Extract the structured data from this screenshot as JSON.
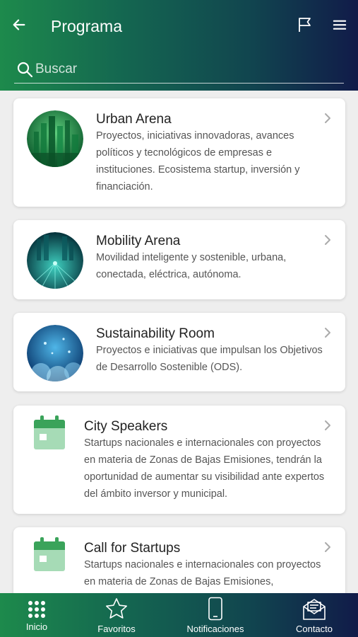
{
  "header": {
    "title": "Programa",
    "search_placeholder": "Buscar"
  },
  "items": [
    {
      "title": "Urban Arena",
      "description": "Proyectos, iniciativas innovadoras, avances políticos y tecnológicos de empresas e instituciones. Ecosistema startup, inversión y financiación.",
      "icon": "urban-arena-image"
    },
    {
      "title": "Mobility Arena",
      "description": "Movilidad inteligente y sostenible, urbana, conectada, eléctrica, autónoma.",
      "icon": "mobility-arena-image"
    },
    {
      "title": "Sustainability Room",
      "description": "Proyectos e iniciativas que impulsan los Objetivos de Desarrollo Sostenible (ODS).",
      "icon": "sustainability-room-image"
    },
    {
      "title": "City Speakers",
      "description": "Startups nacionales e internacionales con proyectos en materia de Zonas de Bajas Emisiones, tendrán la oportunidad de aumentar su visibilidad ante expertos del ámbito inversor y municipal.",
      "icon": "calendar-icon"
    },
    {
      "title": "Call for Startups",
      "description": "Startups nacionales e internacionales con proyectos en materia de Zonas de Bajas Emisiones,",
      "icon": "calendar-icon"
    }
  ],
  "tabs": [
    {
      "label": "Inicio",
      "icon": "grid-icon"
    },
    {
      "label": "Favoritos",
      "icon": "star-icon"
    },
    {
      "label": "Notificaciones",
      "icon": "phone-icon"
    },
    {
      "label": "Contacto",
      "icon": "mail-icon"
    }
  ],
  "colors": {
    "gradient_start": "#1d8a4c",
    "gradient_end": "#111b49",
    "calendar_green": "#3aa35a"
  }
}
